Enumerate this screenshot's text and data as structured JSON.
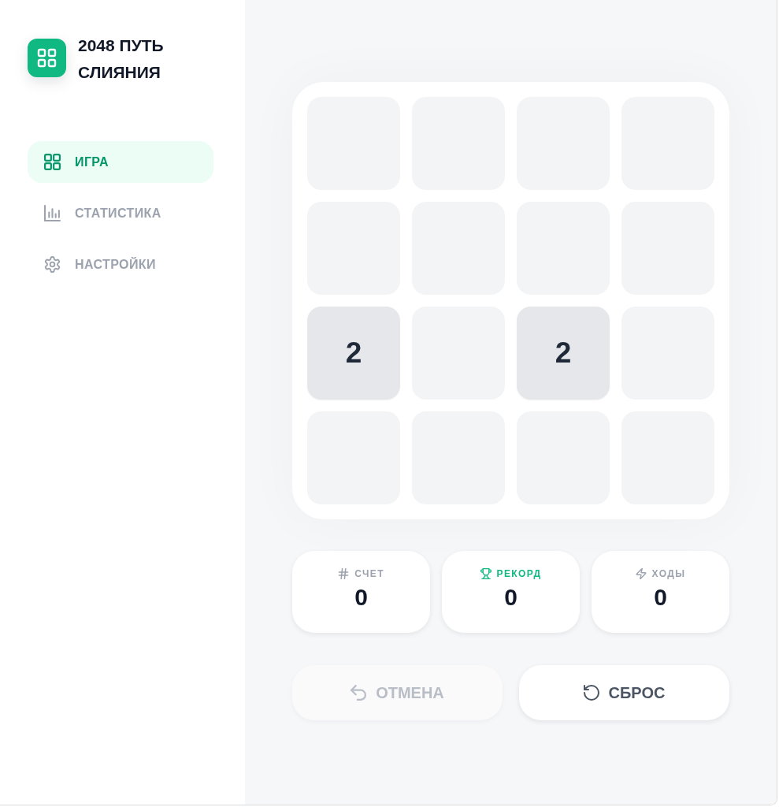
{
  "app": {
    "title": "2048 ПУТЬ СЛИЯНИЯ"
  },
  "nav": [
    {
      "label": "ИГРА",
      "selected": true
    },
    {
      "label": "СТАТИСТИКА",
      "selected": false
    },
    {
      "label": "НАСТРОЙКИ",
      "selected": false
    }
  ],
  "board": {
    "rows": [
      [
        null,
        null,
        null,
        null
      ],
      [
        null,
        null,
        null,
        null
      ],
      [
        "2",
        null,
        "2",
        null
      ],
      [
        null,
        null,
        null,
        null
      ]
    ]
  },
  "stats": [
    {
      "label": "СЧЕТ",
      "value": "0",
      "highlighted": false
    },
    {
      "label": "РЕКОРД",
      "value": "0",
      "highlighted": true
    },
    {
      "label": "ХОДЫ",
      "value": "0",
      "highlighted": false
    }
  ],
  "actions": [
    {
      "label": "ОТМЕНА",
      "disabled": true
    },
    {
      "label": "СБРОС",
      "disabled": false
    }
  ]
}
